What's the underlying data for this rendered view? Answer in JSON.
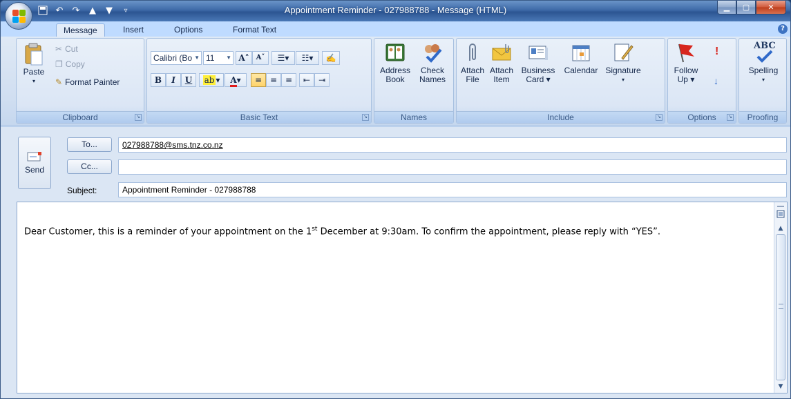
{
  "window": {
    "title": "Appointment Reminder - 027988788  -  Message (HTML)"
  },
  "ribbon": {
    "tabs": [
      {
        "label": "Message",
        "active": true
      },
      {
        "label": "Insert",
        "active": false
      },
      {
        "label": "Options",
        "active": false
      },
      {
        "label": "Format Text",
        "active": false
      }
    ],
    "clipboard": {
      "group_label": "Clipboard",
      "paste": "Paste",
      "cut": "Cut",
      "copy": "Copy",
      "format_painter": "Format Painter"
    },
    "basic_text": {
      "group_label": "Basic Text",
      "font_name": "Calibri (Bo",
      "font_size": "11",
      "bold": "B",
      "italic": "I",
      "underline": "U"
    },
    "names": {
      "group_label": "Names",
      "address_book_line1": "Address",
      "address_book_line2": "Book",
      "check_names_line1": "Check",
      "check_names_line2": "Names"
    },
    "include": {
      "group_label": "Include",
      "attach_file_line1": "Attach",
      "attach_file_line2": "File",
      "attach_item_line1": "Attach",
      "attach_item_line2": "Item",
      "business_card_line1": "Business",
      "business_card_line2": "Card ▾",
      "calendar": "Calendar",
      "signature": "Signature"
    },
    "options": {
      "group_label": "Options",
      "follow_up_line1": "Follow",
      "follow_up_line2": "Up ▾"
    },
    "proofing": {
      "group_label": "Proofing",
      "spelling": "Spelling",
      "abc": "ABC"
    }
  },
  "compose": {
    "send_label": "Send",
    "to_button": "To...",
    "cc_button": "Cc...",
    "subject_label": "Subject:",
    "to_value": "027988788@sms.tnz.co.nz",
    "cc_value": "",
    "subject_value": "Appointment Reminder - 027988788",
    "body": {
      "before_sup": "Dear Customer, this is a reminder of your appointment on the 1",
      "sup": "st",
      "after_sup": " December at 9:30am. To confirm the appointment, please reply with “YES”."
    }
  },
  "icons": {
    "help": "?"
  }
}
